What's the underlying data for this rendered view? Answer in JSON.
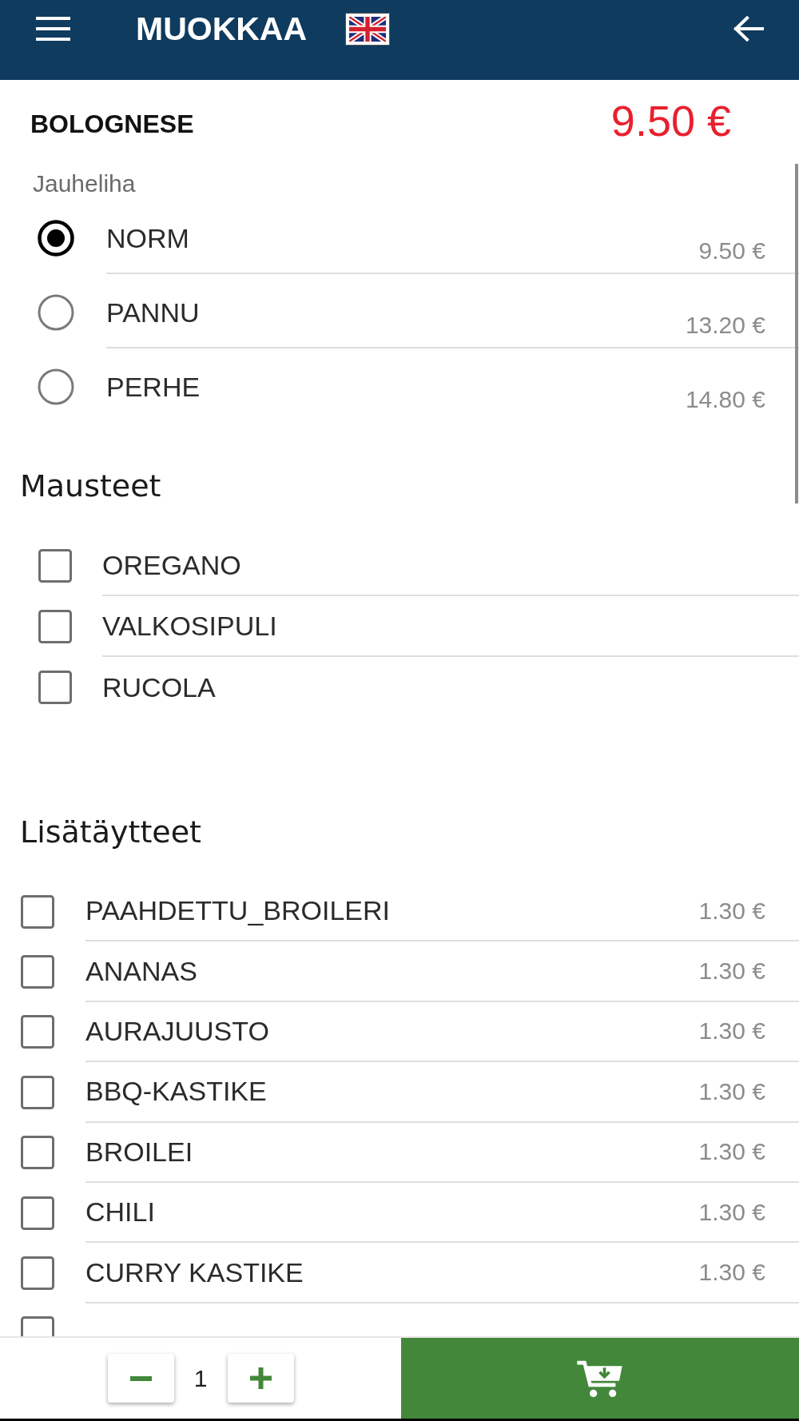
{
  "header": {
    "title": "MUOKKAA"
  },
  "product": {
    "name": "BOLOGNESE",
    "price": "9.50 €"
  },
  "option_groups": [
    {
      "kind": "radio",
      "title": "Jauheliha",
      "items": [
        {
          "label": "NORM",
          "price": "9.50 €",
          "selected": true
        },
        {
          "label": "PANNU",
          "price": "13.20 €",
          "selected": false
        },
        {
          "label": "PERHE",
          "price": "14.80 €",
          "selected": false
        }
      ]
    },
    {
      "kind": "checkbox",
      "title": "Mausteet",
      "items": [
        {
          "label": "OREGANO",
          "checked": false
        },
        {
          "label": "VALKOSIPULI",
          "checked": false
        },
        {
          "label": "RUCOLA",
          "checked": false
        }
      ]
    },
    {
      "kind": "checkbox",
      "title": "Lisätäytteet",
      "items": [
        {
          "label": "PAAHDETTU_BROILERI",
          "price": "1.30 €",
          "checked": false
        },
        {
          "label": "ANANAS",
          "price": "1.30 €",
          "checked": false
        },
        {
          "label": "AURAJUUSTO",
          "price": "1.30 €",
          "checked": false
        },
        {
          "label": "BBQ-KASTIKE",
          "price": "1.30 €",
          "checked": false
        },
        {
          "label": "BROILEI",
          "price": "1.30 €",
          "checked": false
        },
        {
          "label": "CHILI",
          "price": "1.30 €",
          "checked": false
        },
        {
          "label": "CURRY KASTIKE",
          "price": "1.30 €",
          "checked": false
        },
        {
          "checked": false
        }
      ]
    }
  ],
  "quantity": {
    "value": "1"
  }
}
